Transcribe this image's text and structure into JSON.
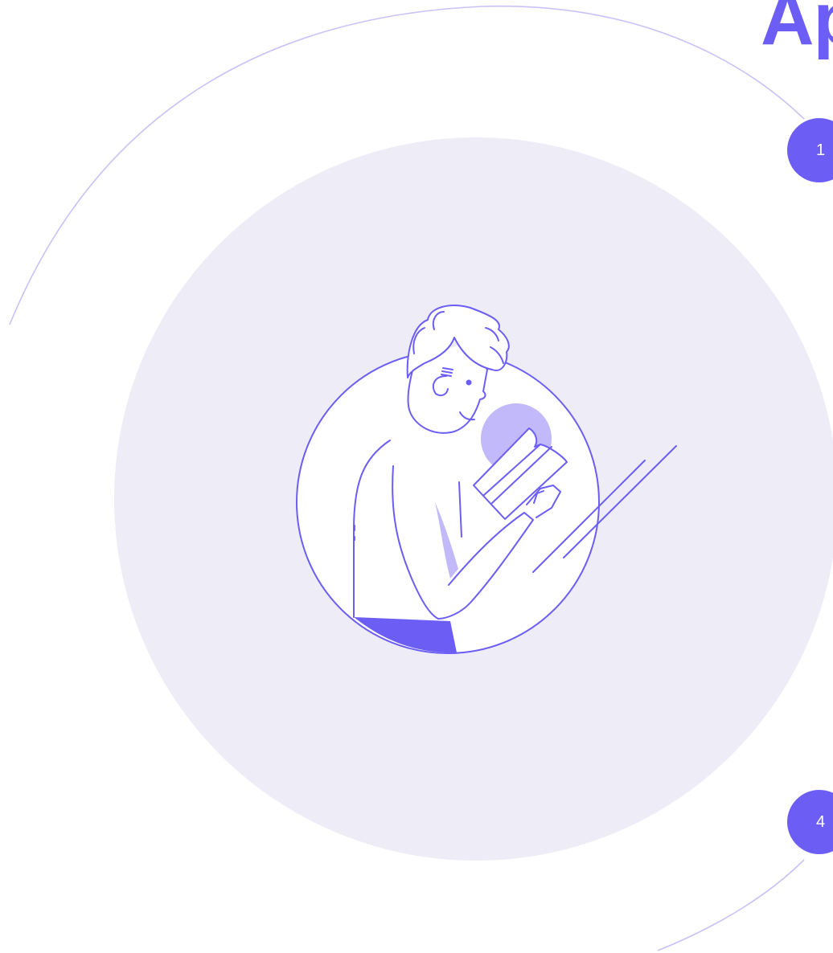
{
  "heading": {
    "text": "Ap"
  },
  "steps": [
    {
      "number": "1"
    },
    {
      "number": "4"
    }
  ],
  "colors": {
    "accent": "#6c5ef5",
    "accent_light": "#c2b9fb",
    "outline": "#6c5ef5",
    "disc": "#eeecf6",
    "orbit": "#c9c1f7",
    "background": "#ffffff"
  },
  "illustration": {
    "icon": "person-reading-book-icon"
  }
}
